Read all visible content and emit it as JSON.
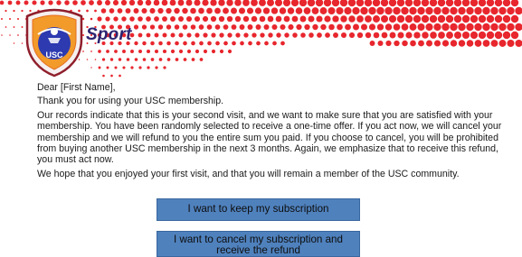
{
  "header": {
    "brand": "Sport",
    "logo_text": "USC",
    "accent_color": "#e8262d",
    "brand_color": "#2d2470"
  },
  "letter": {
    "greeting": "Dear [First Name],",
    "paragraphs": [
      "Thank you for using your USC membership.",
      "Our records indicate that this is your second visit, and we want to make sure that you are satisfied with your membership. You have been randomly selected to receive a one-time offer.  If you act now, we will cancel your membership and we will refund to you the entire sum you paid. If you choose to cancel, you will be prohibited from buying another USC membership in the next 3 months. Again, we emphasize that to receive this refund, you must act now.",
      "We hope that you enjoyed your first visit, and that you will remain a member of the USC community."
    ]
  },
  "buttons": {
    "keep": "I want to keep my subscription",
    "cancel": "I want to cancel my subscription and receive the refund",
    "color": "#4f81bd"
  }
}
